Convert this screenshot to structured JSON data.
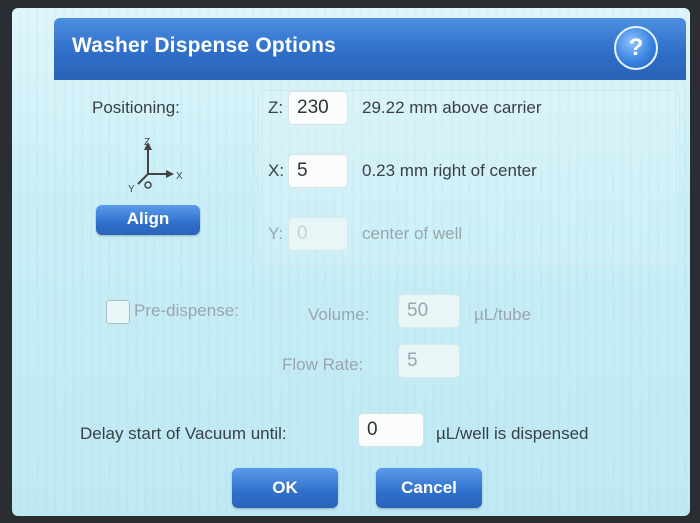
{
  "dialog": {
    "title": "Washer Dispense Options"
  },
  "positioning": {
    "label": "Positioning:",
    "axis_labels": {
      "z": "Z",
      "x": "X",
      "y": "Y"
    },
    "align_label": "Align"
  },
  "z": {
    "label": "Z:",
    "value": "230",
    "desc": "29.22 mm above carrier"
  },
  "x": {
    "label": "X:",
    "value": "5",
    "desc": "0.23 mm right of center"
  },
  "y": {
    "label": "Y:",
    "value": "0",
    "desc": "center of well"
  },
  "predispense": {
    "label": "Pre-dispense:",
    "volume_label": "Volume:",
    "volume_value": "50",
    "volume_unit": "µL/tube",
    "flow_label": "Flow Rate:",
    "flow_value": "5"
  },
  "delay": {
    "label": "Delay start of Vacuum until:",
    "value": "0",
    "unit": "µL/well is dispensed"
  },
  "buttons": {
    "ok": "OK",
    "cancel": "Cancel"
  },
  "colors": {
    "title_bar": "#2f6fc8",
    "button": "#2f70cc",
    "background": "#c9eef6"
  }
}
